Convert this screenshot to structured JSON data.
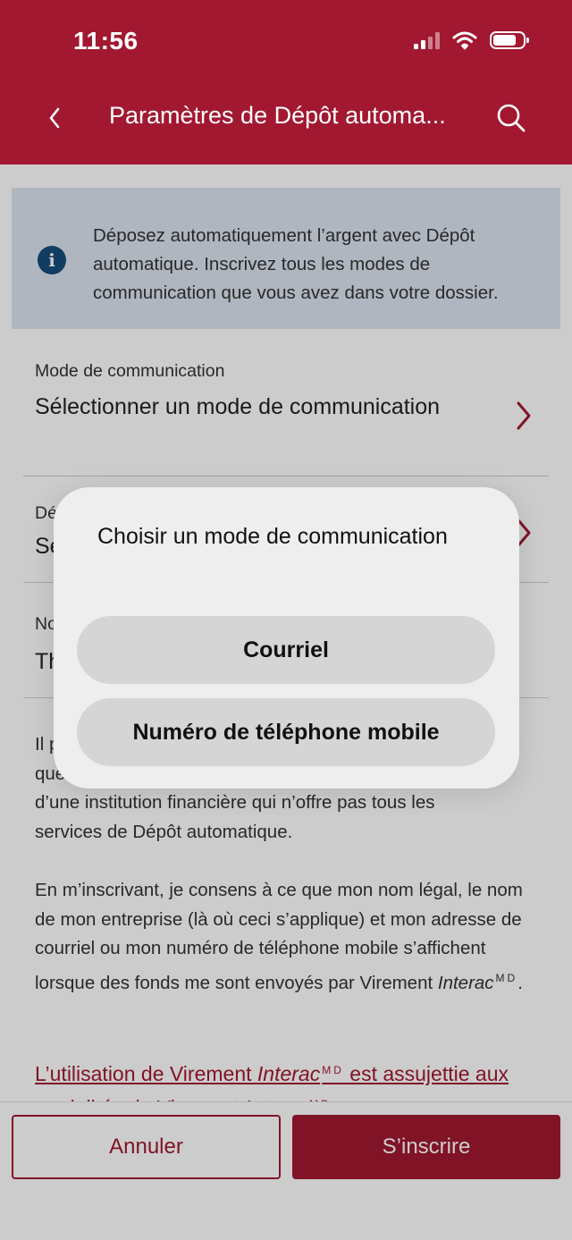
{
  "status_bar": {
    "time": "11:56",
    "icons": [
      "cellular-signal-icon",
      "wifi-icon",
      "battery-icon"
    ]
  },
  "header": {
    "title": "Paramètres de Dépôt automa...",
    "back_icon": "chevron-left-icon",
    "search_icon": "search-icon"
  },
  "info_banner": {
    "icon": "info-icon",
    "text": "Déposez automatiquement l’argent avec Dépôt automatique. Inscrivez tous les modes de communication que vous avez dans votre dossier."
  },
  "fields": [
    {
      "label": "Mode de communication",
      "value": "Sélectionner un mode de communication"
    },
    {
      "label": "Dé",
      "value": "Sé"
    },
    {
      "label": "No",
      "value": "Th"
    }
  ],
  "body": {
    "paragraph1_lines": [
      "Il p",
      "que",
      "d’une institution financière qui n’offre pas tous les",
      "services de Dépôt automatique."
    ],
    "paragraph2_main": "En m’inscrivant, je consens à ce que mon nom légal, le nom de mon entreprise (là où ceci s’applique) et mon adresse de courriel ou mon numéro de téléphone mobile s’affichent lorsque des fonds me sont envoyés par Virement ",
    "brand": "Interac",
    "md": "MD",
    "period": ".",
    "link_prefix": "L’utilisation de Virement ",
    "link_middle": " est assujettie aux modalités de Virement "
  },
  "footer": {
    "cancel_label": "Annuler",
    "submit_label": "S’inscrire"
  },
  "dialog": {
    "title": "Choisir un mode de communication",
    "options": [
      "Courriel",
      "Numéro de téléphone mobile"
    ]
  },
  "colors": {
    "brand_red": "#a21831",
    "info_bg": "#dbe4f0",
    "info_icon": "#154d7a"
  }
}
